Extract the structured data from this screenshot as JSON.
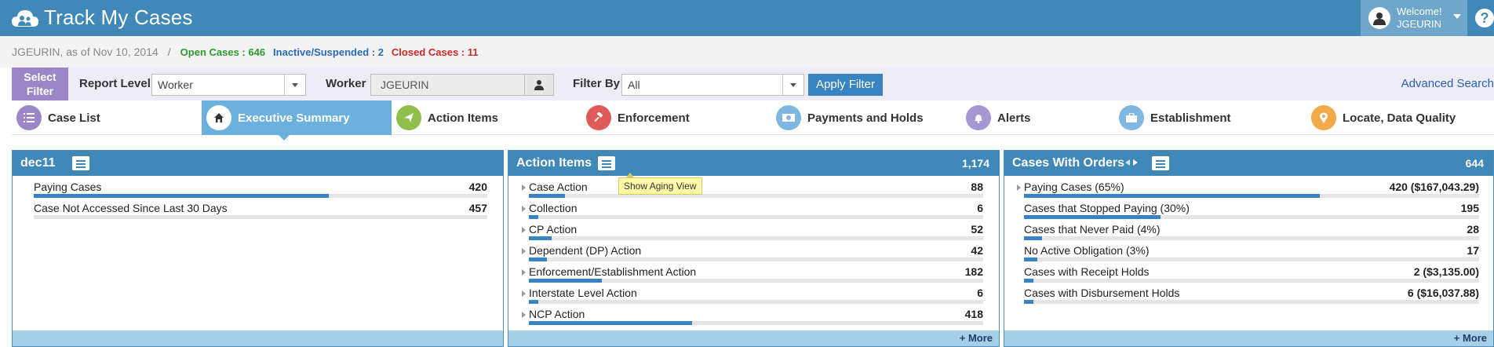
{
  "header": {
    "app_title": "Track My Cases",
    "welcome": "Welcome!",
    "username": "JGEURIN",
    "help": "?"
  },
  "infobar": {
    "user_date": "JGEURIN, as of Nov 10, 2014",
    "separator": "/",
    "open_cases": "Open Cases : 646",
    "inactive_cases": "Inactive/Suspended : 2",
    "closed_cases": "Closed Cases : 11"
  },
  "filter": {
    "select_filter_line1": "Select",
    "select_filter_line2": "Filter",
    "report_level_label": "Report Level",
    "report_level_value": "Worker",
    "worker_label": "Worker",
    "worker_value": "JGEURIN",
    "filter_by_label": "Filter By",
    "filter_by_value": "All",
    "apply_label": "Apply Filter",
    "advanced_search": "Advanced Search"
  },
  "tabs": [
    {
      "label": "Case List",
      "color": "#9b87c7",
      "icon": "list-icon"
    },
    {
      "label": "Executive Summary",
      "color": "#ffffff",
      "icon": "home-icon"
    },
    {
      "label": "Action Items",
      "color": "#8fbf4a",
      "icon": "paper-plane-icon"
    },
    {
      "label": "Enforcement",
      "color": "#e05a5a",
      "icon": "gavel-icon"
    },
    {
      "label": "Payments and Holds",
      "color": "#7fb7e0",
      "icon": "money-icon"
    },
    {
      "label": "Alerts",
      "color": "#a597d1",
      "icon": "bell-icon"
    },
    {
      "label": "Establishment",
      "color": "#7fb7e0",
      "icon": "briefcase-icon"
    },
    {
      "label": "Locate, Data Quality",
      "color": "#f2a94a",
      "icon": "map-marker-icon"
    }
  ],
  "panels": {
    "dec11": {
      "title": "dec11",
      "rows": [
        {
          "label": "Paying Cases",
          "value": "420",
          "fraction": 0.65
        },
        {
          "label": "Case Not Accessed Since Last 30 Days",
          "value": "457",
          "fraction": 0.0
        }
      ]
    },
    "action_items": {
      "title": "Action Items",
      "total": "1,174",
      "tooltip": "Show Aging View",
      "more": "+ More",
      "rows": [
        {
          "label": "Case Action",
          "value": "88",
          "fraction": 0.08
        },
        {
          "label": "Collection",
          "value": "6",
          "fraction": 0.02
        },
        {
          "label": "CP Action",
          "value": "52",
          "fraction": 0.05
        },
        {
          "label": "Dependent (DP) Action",
          "value": "42",
          "fraction": 0.04
        },
        {
          "label": "Enforcement/Establishment Action",
          "value": "182",
          "fraction": 0.16
        },
        {
          "label": "Interstate Level Action",
          "value": "6",
          "fraction": 0.02
        },
        {
          "label": "NCP Action",
          "value": "418",
          "fraction": 0.36
        }
      ]
    },
    "cases_with_orders": {
      "title": "Cases With Orders",
      "total": "644",
      "more": "+ More",
      "rows": [
        {
          "label": "Paying Cases (65%)",
          "value": "420 ($167,043.29)",
          "fraction": 0.65
        },
        {
          "label": "Cases that Stopped Paying (30%)",
          "value": "195",
          "fraction": 0.3
        },
        {
          "label": "Cases that Never Paid (4%)",
          "value": "28",
          "fraction": 0.04
        },
        {
          "label": "No Active Obligation (3%)",
          "value": "17",
          "fraction": 0.03
        },
        {
          "label": "Cases with Receipt Holds",
          "value": "2 ($3,135.00)",
          "fraction": 0.02
        },
        {
          "label": "Cases with Disbursement Holds",
          "value": "6 ($16,037.88)",
          "fraction": 0.02
        }
      ]
    }
  }
}
